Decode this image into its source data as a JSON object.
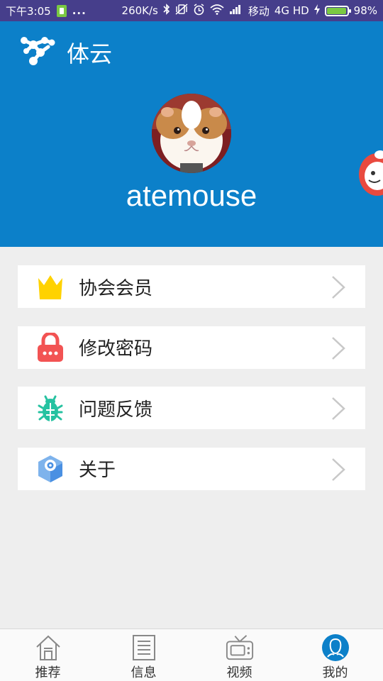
{
  "status_bar": {
    "time": "下午3:05",
    "dots": "...",
    "speed": "260K/s",
    "carrier": "移动",
    "network": "4G HD",
    "battery": "98%",
    "battery_level": 0.98,
    "icons": [
      "sim-card-icon",
      "bluetooth-icon",
      "vibrate-off-icon",
      "alarm-icon",
      "wifi-icon",
      "signal-icon",
      "charging-icon",
      "battery-icon"
    ]
  },
  "header": {
    "app_title": "体云",
    "username": "atemouse",
    "bg_color": "#0c80c9"
  },
  "menu": {
    "items": [
      {
        "label": "协会会员",
        "icon": "crown-icon",
        "color": "#ffd200"
      },
      {
        "label": "修改密码",
        "icon": "lock-icon",
        "color": "#f25353"
      },
      {
        "label": "问题反馈",
        "icon": "bug-icon",
        "color": "#26c2a1"
      },
      {
        "label": "关于",
        "icon": "info-box-icon",
        "color": "#4a90e2"
      }
    ]
  },
  "tabs": [
    {
      "label": "推荐",
      "icon": "home-icon",
      "active": false
    },
    {
      "label": "信息",
      "icon": "document-icon",
      "active": false
    },
    {
      "label": "视频",
      "icon": "tv-icon",
      "active": false
    },
    {
      "label": "我的",
      "icon": "profile-icon",
      "active": true
    }
  ]
}
